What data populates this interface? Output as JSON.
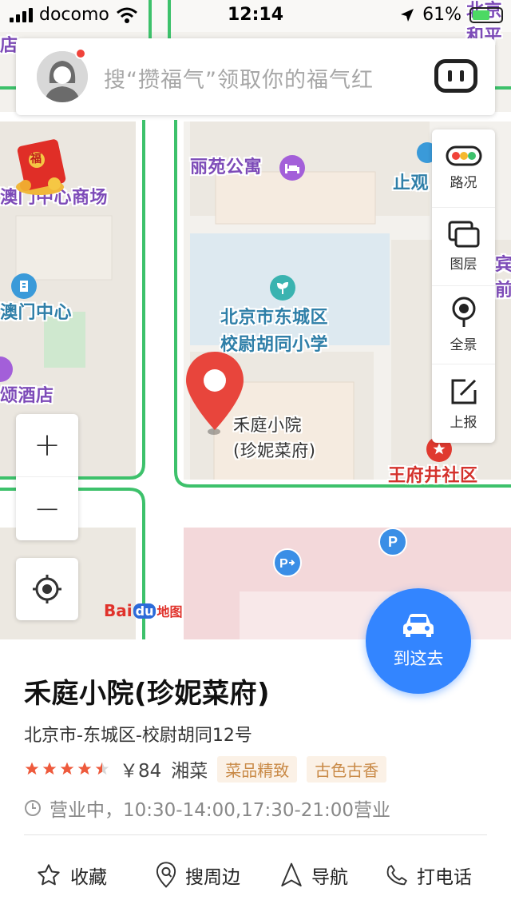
{
  "status_bar": {
    "carrier": "docomo",
    "time": "12:14",
    "battery": "61%",
    "battery_level": 0.61
  },
  "search": {
    "placeholder": "搜“攒福气”领取你的福气红"
  },
  "map": {
    "labels": {
      "lijuan_apartment": "丽苑公寓",
      "aomen_shopping": "澳门中心商场",
      "aomen_center": "澳门中心",
      "hotel_partial": "颂酒店",
      "store_partial": "店",
      "shangguan_partial": "止观",
      "school_line1": "北京市东城区",
      "school_line2": "校尉胡同小学",
      "wangfujing": "王府井社区",
      "selected_line1": "禾庭小院",
      "selected_line2": "(珍妮菜府)",
      "top_right_line1": "北京",
      "top_right_line2": "和平",
      "right_edge_line1": "宾",
      "right_edge_line2": "前"
    },
    "parking_symbol": "P",
    "baidu_logo": {
      "bai": "Bai",
      "du": "du",
      "ditu": "地图"
    },
    "red_packet_char": "福"
  },
  "tools": [
    {
      "id": "traffic",
      "label": "路况",
      "icon": "traffic-light-icon"
    },
    {
      "id": "layers",
      "label": "图层",
      "icon": "layers-icon"
    },
    {
      "id": "panorama",
      "label": "全景",
      "icon": "panorama-pin-icon"
    },
    {
      "id": "report",
      "label": "上报",
      "icon": "edit-report-icon"
    }
  ],
  "zoom": {
    "in": "+",
    "out": "−"
  },
  "go_button": {
    "label": "到这去"
  },
  "place": {
    "title": "禾庭小院(珍妮菜府)",
    "address": "北京市-东城区-校尉胡同12号",
    "rating": 4.5,
    "price": "￥84",
    "cuisine": "湘菜",
    "tags": [
      "菜品精致",
      "古色古香"
    ],
    "hours": "营业中，10:30-14:00,17:30-21:00营业"
  },
  "actions": [
    {
      "id": "favorite",
      "label": "收藏",
      "icon": "star-outline-icon"
    },
    {
      "id": "nearby",
      "label": "搜周边",
      "icon": "location-search-icon"
    },
    {
      "id": "navigate",
      "label": "导航",
      "icon": "navigation-arrow-icon"
    },
    {
      "id": "call",
      "label": "打电话",
      "icon": "phone-icon"
    }
  ],
  "colors": {
    "accent_blue": "#3385ff",
    "poi_purple": "#a35fd9",
    "poi_teal": "#3ab3b0",
    "marker_red": "#e8453c",
    "road_green": "#3dc16b"
  }
}
